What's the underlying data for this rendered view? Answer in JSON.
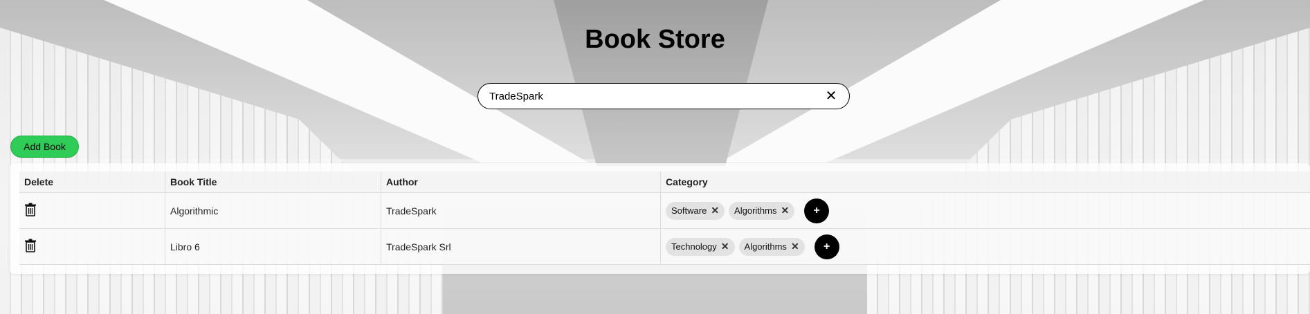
{
  "header": {
    "title": "Book Store"
  },
  "search": {
    "value": "TradeSpark",
    "clear_icon": "close-icon"
  },
  "actions": {
    "add_book_label": "Add Book"
  },
  "table": {
    "columns": [
      "Delete",
      "Book Title",
      "Author",
      "Category"
    ],
    "rows": [
      {
        "title": "Algorithmic",
        "author": "TradeSpark",
        "categories": [
          "Software",
          "Algorithms"
        ]
      },
      {
        "title": "Libro 6",
        "author": "TradeSpark Srl",
        "categories": [
          "Technology",
          "Algorithms"
        ]
      }
    ],
    "remove_glyph": "✕",
    "add_glyph": "+"
  },
  "colors": {
    "add_button": "#2fcc57",
    "tag_bg": "#e2e2e2",
    "add_category_button": "#000000"
  }
}
